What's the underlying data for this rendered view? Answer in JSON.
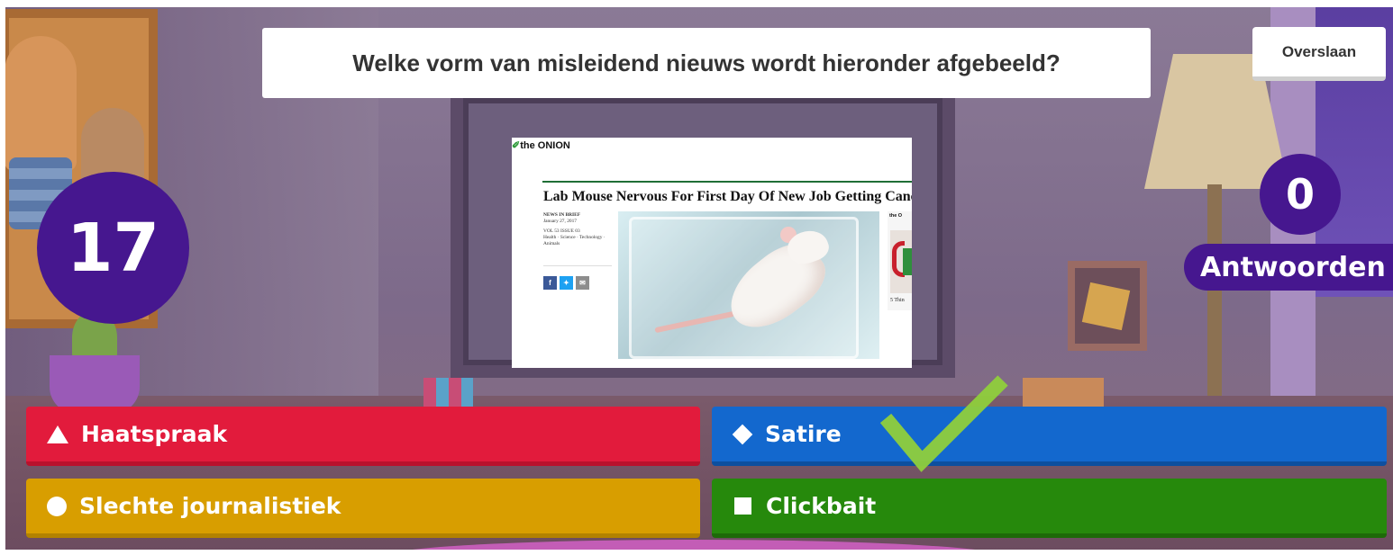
{
  "question": "Welke vorm van misleidend nieuws wordt hieronder afgebeeld?",
  "skip_label": "Overslaan",
  "timer": "17",
  "answer_count": "0",
  "answer_count_label": "Antwoorden",
  "media": {
    "logo": "the ONION",
    "headline": "Lab Mouse Nervous For First Day Of New Job Getting Cancer",
    "section": "NEWS IN BRIEF",
    "date": "January 27, 2017",
    "volume": "VOL 53 ISSUE 03",
    "tags": "Health · Science · Technology · Animals",
    "share_icons": [
      "facebook-icon",
      "twitter-icon",
      "email-icon"
    ],
    "sidebar_logo": "the O",
    "sidebar_caption": "5 Thin"
  },
  "answers": [
    {
      "label": "Haatspraak",
      "shape": "triangle",
      "color": "#e21b3c"
    },
    {
      "label": "Satire",
      "shape": "diamond",
      "color": "#1368ce",
      "correct": true
    },
    {
      "label": "Slechte journalistiek",
      "shape": "circle",
      "color": "#d89e00"
    },
    {
      "label": "Clickbait",
      "shape": "square",
      "color": "#26890c"
    }
  ],
  "colors": {
    "brand_purple": "#46178f",
    "check_green": "#8fcf3c"
  }
}
